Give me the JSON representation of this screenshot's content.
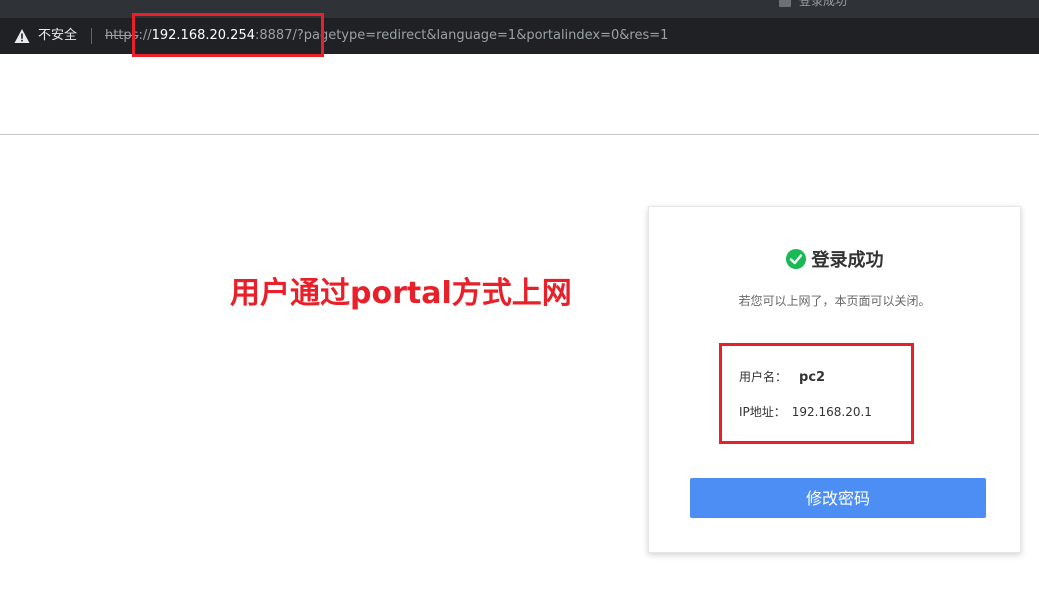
{
  "browser": {
    "tab_title": "登录成功",
    "security_label": "不安全",
    "url": {
      "scheme": "https",
      "sep": "://",
      "host": "192.168.20.254",
      "rest": ":8887/?pagetype=redirect&language=1&portalindex=0&res=1"
    }
  },
  "annotation": {
    "text": "用户通过portal方式上网",
    "color": "#e8202a"
  },
  "card": {
    "title": "登录成功",
    "subtitle": "若您可以上网了，本页面可以关闭。",
    "username_label": "用户名：",
    "username_value": "pc2",
    "ip_label": "IP地址：",
    "ip_value": "192.168.20.1",
    "change_password_label": "修改密码",
    "accent_color": "#4d8ef5",
    "success_color": "#19b955"
  }
}
